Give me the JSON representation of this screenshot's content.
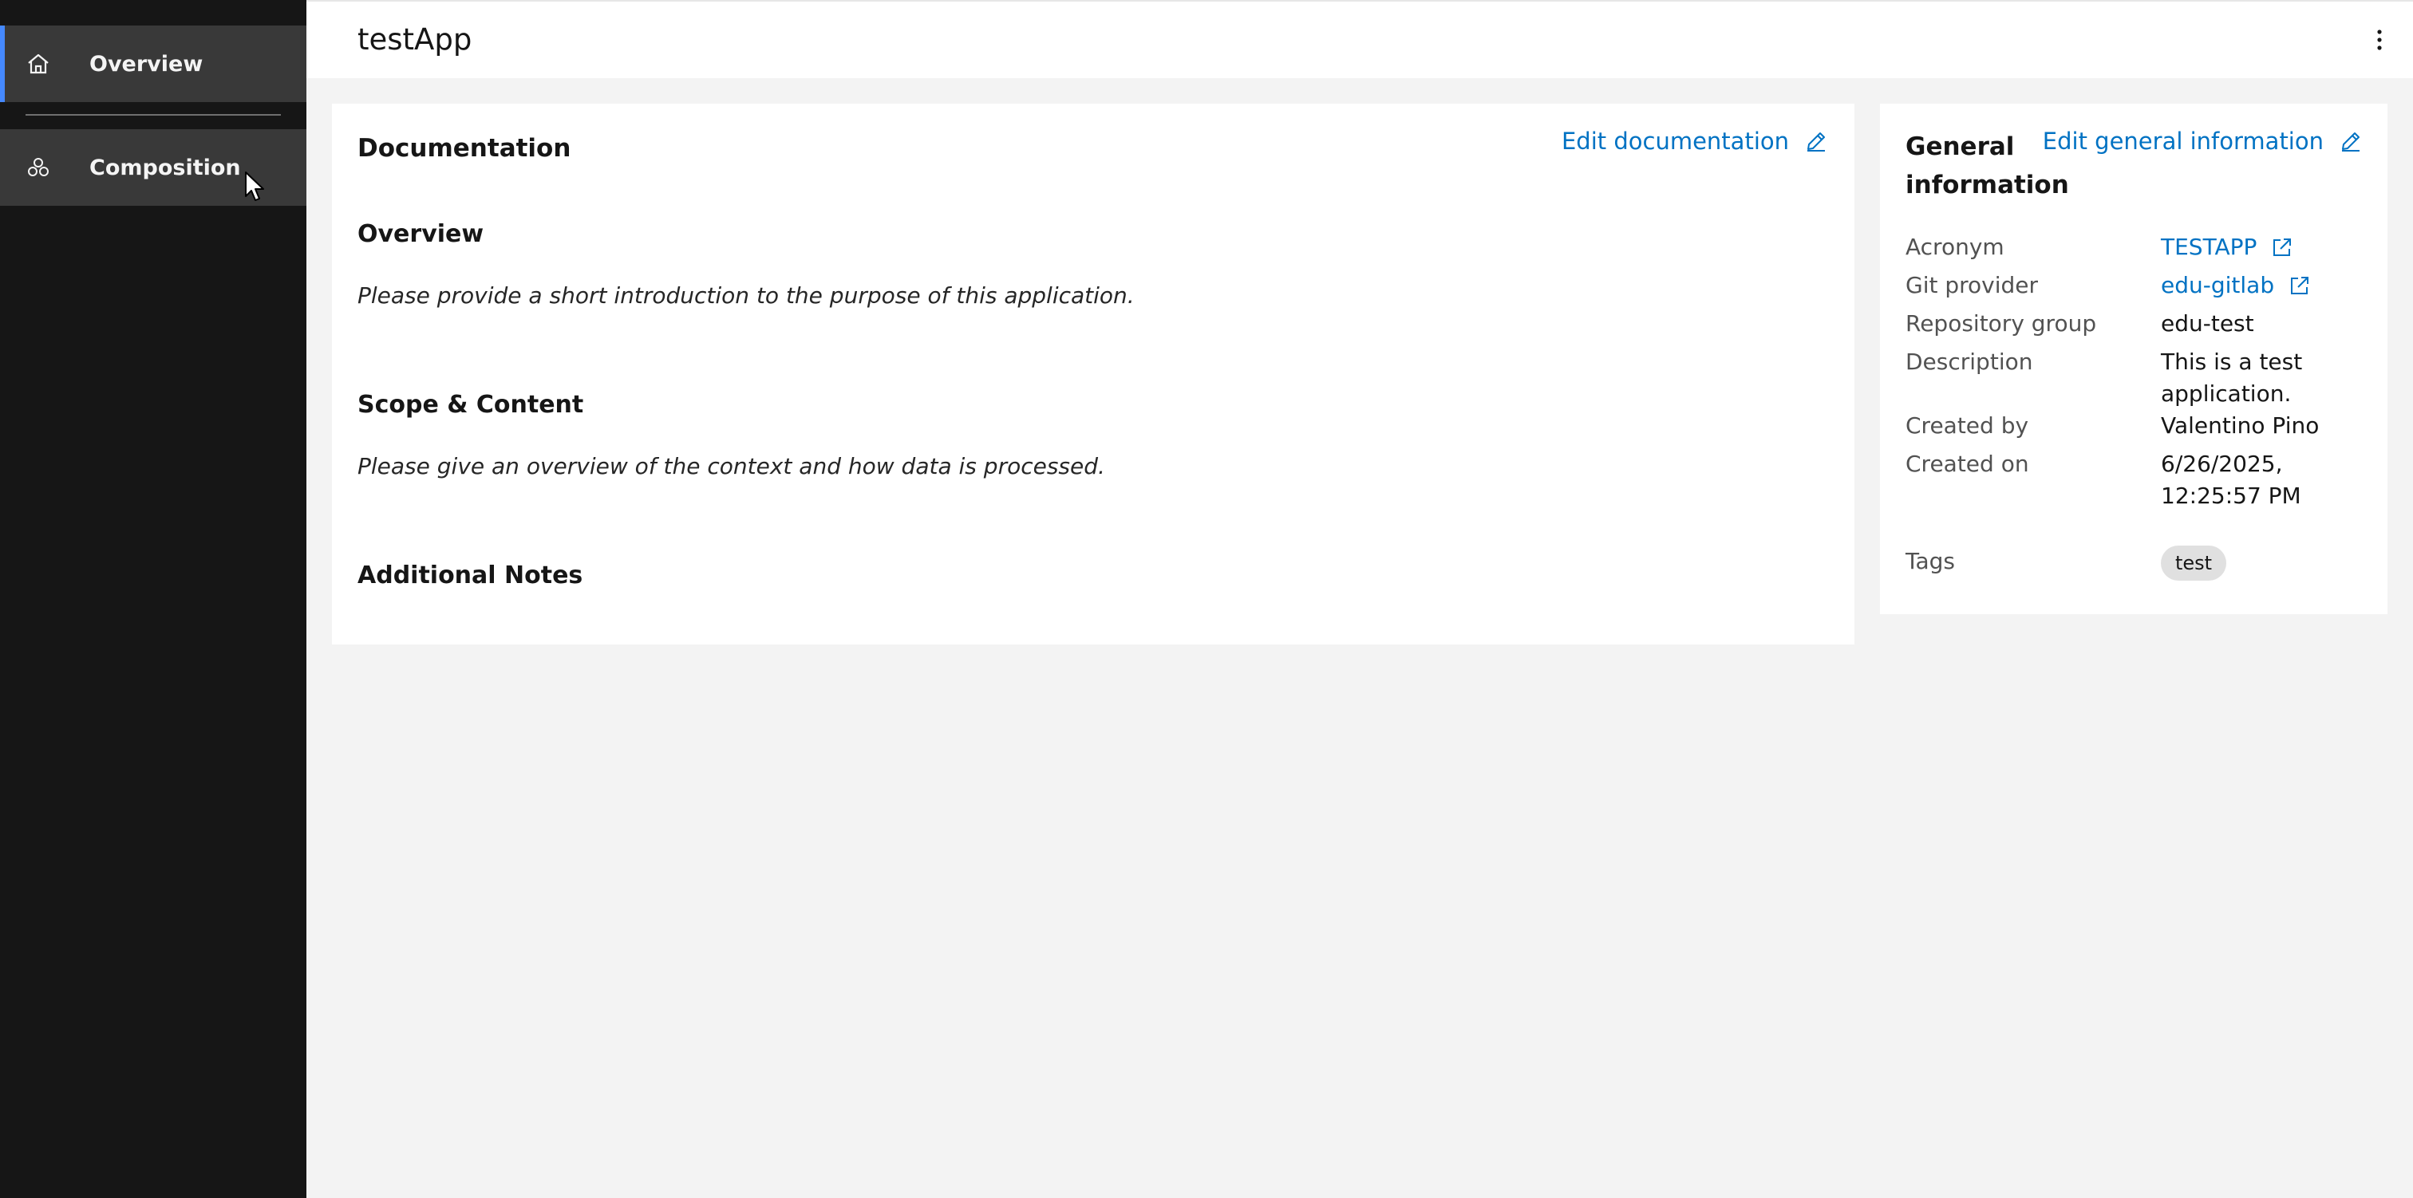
{
  "colors": {
    "sidebar_bg": "#161616",
    "sidebar_item_bg": "#393939",
    "active_indicator": "#4589ff",
    "link": "#0072c3",
    "page_bg": "#f3f3f3",
    "card_bg": "#ffffff",
    "tag_bg": "#e0e0e0"
  },
  "sidebar": {
    "items": [
      {
        "label": "Overview",
        "icon": "home-icon",
        "active": true
      },
      {
        "label": "Composition",
        "icon": "cluster-icon",
        "active": false
      }
    ]
  },
  "header": {
    "title": "testApp",
    "menu_icon": "overflow-menu-vertical-icon"
  },
  "documentation": {
    "title": "Documentation",
    "edit_label": "Edit documentation",
    "sections": [
      {
        "heading": "Overview",
        "body": "Please provide a short introduction to the purpose of this application."
      },
      {
        "heading": "Scope & Content",
        "body": "Please give an overview of the context and how data is processed."
      },
      {
        "heading": "Additional Notes",
        "body": ""
      }
    ]
  },
  "general_info": {
    "title": "General information",
    "edit_label": "Edit general information",
    "acronym": {
      "label": "Acronym",
      "value": "TESTAPP"
    },
    "git_provider": {
      "label": "Git provider",
      "value": "edu-gitlab"
    },
    "repository_group": {
      "label": "Repository group",
      "value": "edu-test"
    },
    "description": {
      "label": "Description",
      "value": "This is a test application."
    },
    "created_by": {
      "label": "Created by",
      "value": "Valentino Pino"
    },
    "created_on": {
      "label": "Created on",
      "value": "6/26/2025, 12:25:57 PM"
    },
    "tags": {
      "label": "Tags",
      "values": [
        "test"
      ]
    }
  }
}
